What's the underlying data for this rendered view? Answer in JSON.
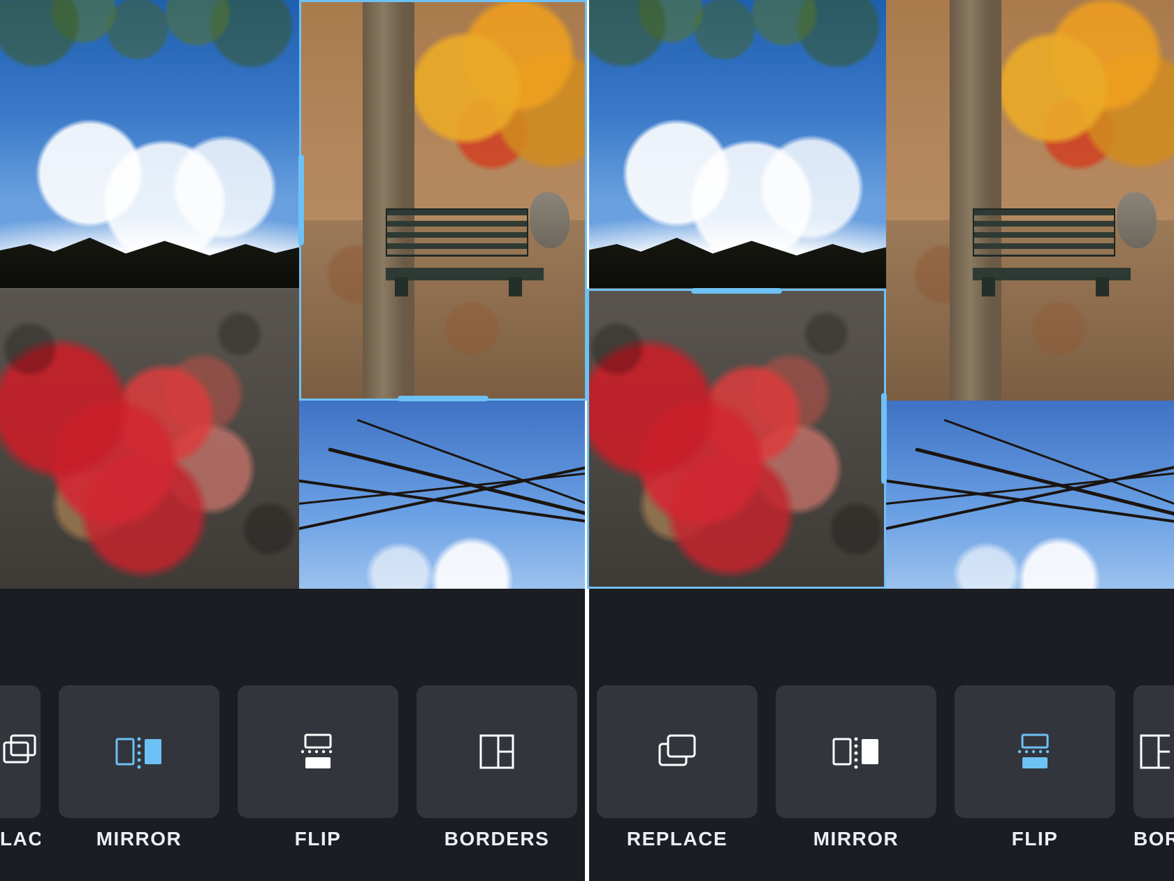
{
  "accent_color": "#6EC1F5",
  "left": {
    "selected_cell": "bench",
    "toolbar": {
      "active": "mirror",
      "items": [
        {
          "id": "replace",
          "label": "LACE"
        },
        {
          "id": "mirror",
          "label": "MIRROR"
        },
        {
          "id": "flip",
          "label": "FLIP"
        },
        {
          "id": "borders",
          "label": "BORDERS"
        }
      ]
    }
  },
  "right": {
    "selected_cell": "red-leaves",
    "toolbar": {
      "active": "flip",
      "items": [
        {
          "id": "replace",
          "label": "REPLACE"
        },
        {
          "id": "mirror",
          "label": "MIRROR"
        },
        {
          "id": "flip",
          "label": "FLIP"
        },
        {
          "id": "borders",
          "label": "BORDERS"
        }
      ]
    }
  }
}
